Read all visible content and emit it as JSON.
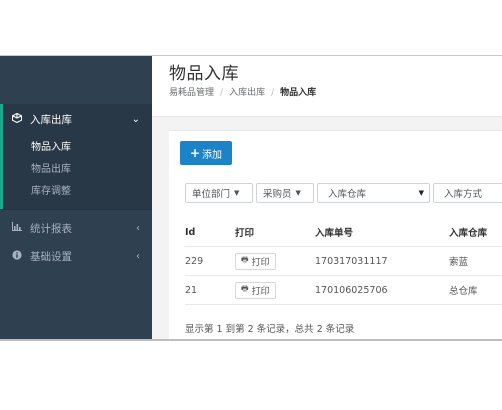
{
  "sidebar": {
    "items": [
      {
        "label": "入库出库",
        "icon": "cube-icon",
        "caret": "⌄"
      },
      {
        "label": "统计报表",
        "icon": "bar-chart-icon",
        "caret": "‹"
      },
      {
        "label": "基础设置",
        "icon": "info-circle-icon",
        "caret": "‹"
      }
    ],
    "subitems": [
      "物品入库",
      "物品出库",
      "库存调整"
    ]
  },
  "header": {
    "title": "物品入库",
    "breadcrumb": [
      "易耗品管理",
      "入库出库",
      "物品入库"
    ]
  },
  "toolbar": {
    "add_label": "添加"
  },
  "filters": {
    "dept": "单位部门",
    "buyer": "采购员",
    "warehouse": "入库仓库",
    "method": "入库方式"
  },
  "table": {
    "headers": [
      "Id",
      "打印",
      "入库单号",
      "入库仓库"
    ],
    "rows": [
      {
        "id": "229",
        "print": "打印",
        "no": "170317031117",
        "warehouse": "索蓝"
      },
      {
        "id": "21",
        "print": "打印",
        "no": "170106025706",
        "warehouse": "总仓库"
      }
    ]
  },
  "summary": "显示第 1 到第 2 条记录，总共 2 条记录",
  "colors": {
    "sidebar_bg": "#2f4050",
    "accent": "#19aa8d",
    "primary_button": "#1c84c6"
  }
}
